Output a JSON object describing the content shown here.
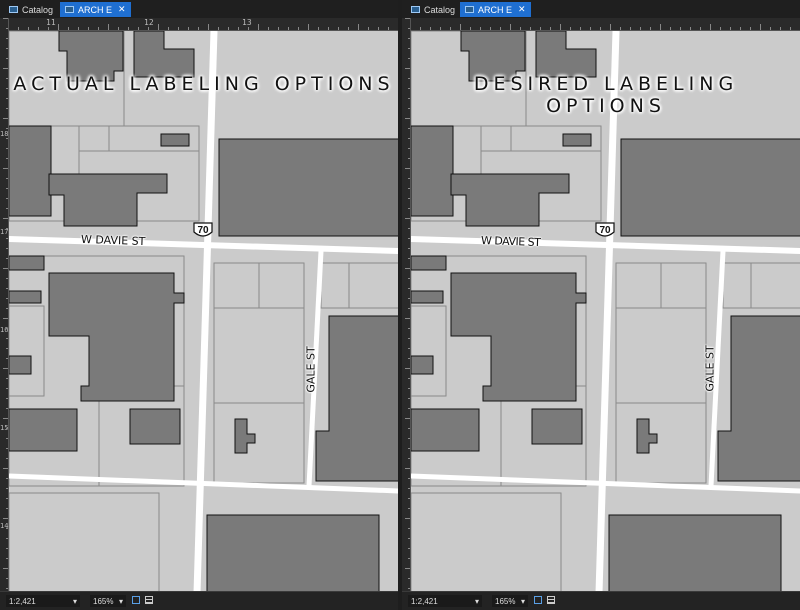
{
  "tabs": {
    "catalog": "Catalog",
    "map": "ARCH E",
    "close": "✕"
  },
  "ruler_top": [
    "11",
    "12",
    "13"
  ],
  "ruler_left": [
    "18",
    "17",
    "16",
    "15",
    "14"
  ],
  "left_map": {
    "title": "ACTUAL LABELING OPTIONS",
    "street_w_davie": "W DAVIE ST",
    "street_gale": "GALE ST",
    "route_shield": "70"
  },
  "right_map": {
    "title": "DESIRED LABELING OPTIONS",
    "street_w_davie": "W DAVIE ST",
    "street_gale": "GALE ST",
    "route_shield": "70"
  },
  "status_bar": {
    "scale": "1:2,421",
    "zoom": "165%",
    "scale_arrow": "▾",
    "zoom_arrow": "▾"
  },
  "colors": {
    "accent": "#1f6fd1",
    "background": "#cbcbcb",
    "building": "#7a7a7a",
    "road": "#ffffff"
  }
}
